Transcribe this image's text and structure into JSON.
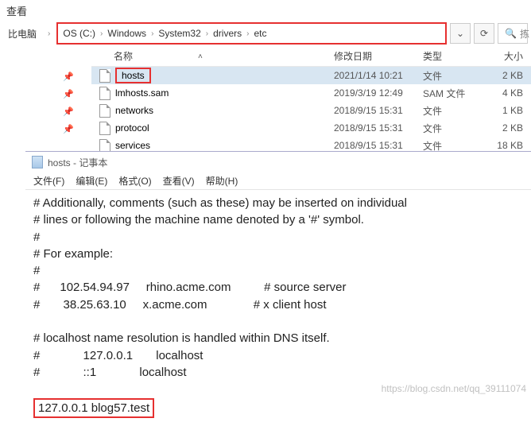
{
  "explorer": {
    "tab_label": "查看",
    "this_pc": "比电脑",
    "breadcrumb": [
      "OS (C:)",
      "Windows",
      "System32",
      "drivers",
      "etc"
    ],
    "refresh_glyph": "⟳",
    "down_glyph": "⌄",
    "search_glyph": "🔍",
    "search_label": "拣",
    "columns": {
      "name": "名称",
      "date": "修改日期",
      "type": "类型",
      "size": "大小"
    },
    "files": [
      {
        "name": "hosts",
        "date": "2021/1/14 10:21",
        "type": "文件",
        "size": "2 KB",
        "selected": true,
        "highlight": true
      },
      {
        "name": "lmhosts.sam",
        "date": "2019/3/19 12:49",
        "type": "SAM 文件",
        "size": "4 KB",
        "selected": false,
        "highlight": false
      },
      {
        "name": "networks",
        "date": "2018/9/15 15:31",
        "type": "文件",
        "size": "1 KB",
        "selected": false,
        "highlight": false
      },
      {
        "name": "protocol",
        "date": "2018/9/15 15:31",
        "type": "文件",
        "size": "2 KB",
        "selected": false,
        "highlight": false
      },
      {
        "name": "services",
        "date": "2018/9/15 15:31",
        "type": "文件",
        "size": "18 KB",
        "selected": false,
        "highlight": false
      }
    ]
  },
  "notepad": {
    "title": "hosts - 记事本",
    "menu": [
      "文件(F)",
      "编辑(E)",
      "格式(O)",
      "查看(V)",
      "帮助(H)"
    ],
    "lines": [
      "# Additionally, comments (such as these) may be inserted on individual",
      "# lines or following the machine name denoted by a '#' symbol.",
      "#",
      "# For example:",
      "#",
      "#      102.54.94.97     rhino.acme.com          # source server",
      "#       38.25.63.10     x.acme.com              # x client host",
      "",
      "# localhost name resolution is handled within DNS itself.",
      "#             127.0.0.1       localhost",
      "#             ::1             localhost",
      ""
    ],
    "highlight_line": "127.0.0.1 blog57.test"
  },
  "watermark": "https://blog.csdn.net/qq_39111074"
}
